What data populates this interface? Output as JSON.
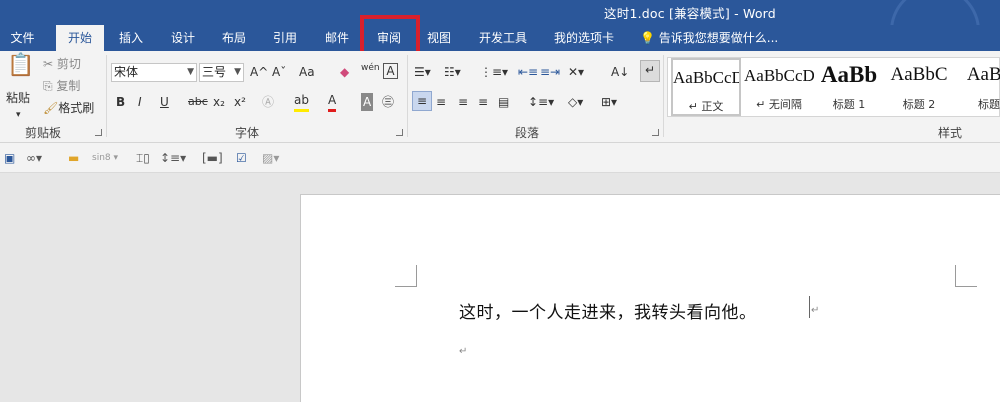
{
  "window": {
    "title": "这时1.doc [兼容模式] - Word"
  },
  "tabs": [
    {
      "label": "文件"
    },
    {
      "label": "开始"
    },
    {
      "label": "插入"
    },
    {
      "label": "设计"
    },
    {
      "label": "布局"
    },
    {
      "label": "引用"
    },
    {
      "label": "邮件"
    },
    {
      "label": "审阅"
    },
    {
      "label": "视图"
    },
    {
      "label": "开发工具"
    },
    {
      "label": "我的选项卡"
    }
  ],
  "tell_me": "告诉我您想要做什么...",
  "clipboard": {
    "paste": "粘贴",
    "cut": "剪切",
    "copy": "复制",
    "format_painter": "格式刷",
    "group": "剪贴板"
  },
  "font": {
    "name": "宋体",
    "size": "三号",
    "group": "字体",
    "bold": "B",
    "italic": "I",
    "underline": "U",
    "strike": "abc",
    "subscript": "x₂",
    "superscript": "x²",
    "grow": "A^",
    "shrink": "Aˇ",
    "case": "Aa",
    "phonetic": "wén",
    "font_color": "A",
    "shading": "A"
  },
  "paragraph": {
    "group": "段落"
  },
  "styles": {
    "group": "样式",
    "items": [
      {
        "sample": "AaBbCcDd",
        "name": "↵ 正文"
      },
      {
        "sample": "AaBbCcDd",
        "name": "↵ 无间隔"
      },
      {
        "sample": "AaBb",
        "name": "标题 1"
      },
      {
        "sample": "AaBbC",
        "name": "标题 2"
      },
      {
        "sample": "AaBb",
        "name": "标题"
      }
    ]
  },
  "quick_toolbar": {
    "sin": "sin8"
  },
  "document": {
    "line1": "这时，一个人走进来，我转头看向他。"
  },
  "colors": {
    "brand": "#2b579a",
    "highlight_box": "#d9202c"
  }
}
